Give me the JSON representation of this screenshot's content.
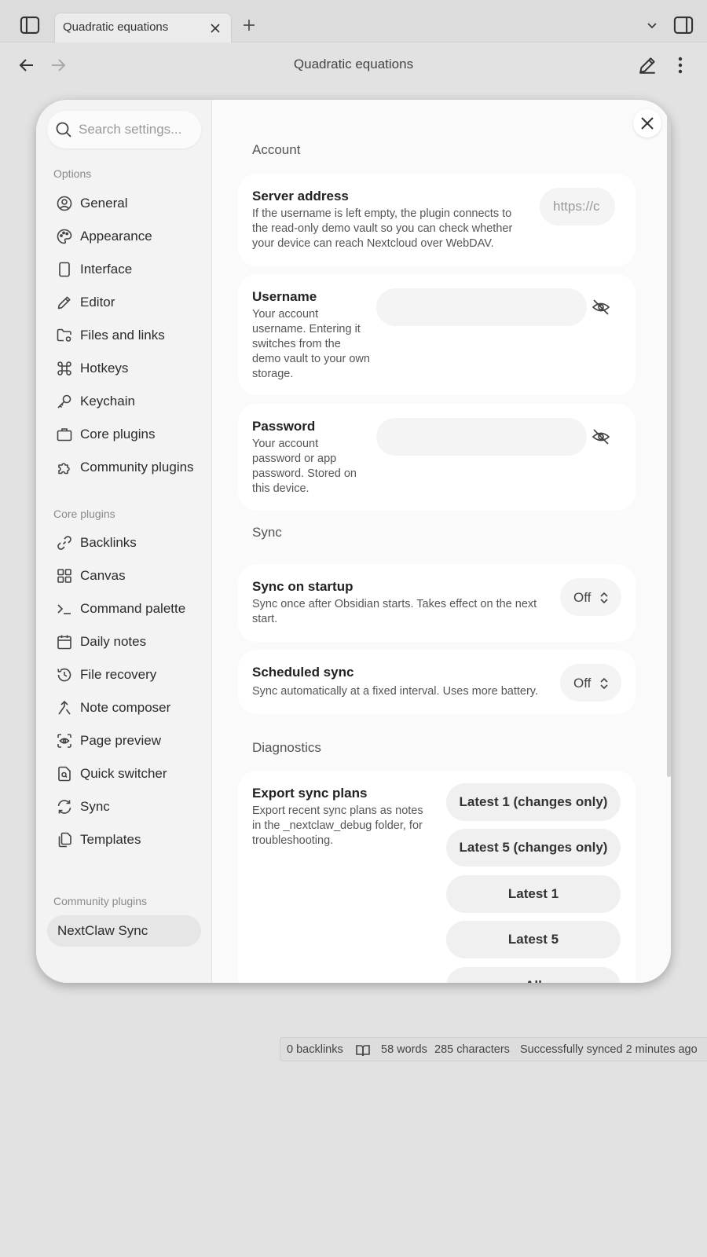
{
  "tab": {
    "title": "Quadratic equations"
  },
  "nav": {
    "title": "Quadratic equations"
  },
  "sidebar": {
    "search_placeholder": "Search settings...",
    "options_label": "Options",
    "options": [
      {
        "label": "General",
        "icon": "user-circle-icon"
      },
      {
        "label": "Appearance",
        "icon": "palette-icon"
      },
      {
        "label": "Interface",
        "icon": "tablet-icon"
      },
      {
        "label": "Editor",
        "icon": "pencil-icon"
      },
      {
        "label": "Files and links",
        "icon": "folder-cog-icon"
      },
      {
        "label": "Hotkeys",
        "icon": "command-icon"
      },
      {
        "label": "Keychain",
        "icon": "key-icon"
      },
      {
        "label": "Core plugins",
        "icon": "briefcase-icon"
      },
      {
        "label": "Community plugins",
        "icon": "puzzle-icon"
      }
    ],
    "core_label": "Core plugins",
    "core": [
      {
        "label": "Backlinks",
        "icon": "link-icon"
      },
      {
        "label": "Canvas",
        "icon": "layout-grid-icon"
      },
      {
        "label": "Command palette",
        "icon": "terminal-icon"
      },
      {
        "label": "Daily notes",
        "icon": "calendar-icon"
      },
      {
        "label": "File recovery",
        "icon": "history-icon"
      },
      {
        "label": "Note composer",
        "icon": "merge-icon"
      },
      {
        "label": "Page preview",
        "icon": "scan-eye-icon"
      },
      {
        "label": "Quick switcher",
        "icon": "file-search-icon"
      },
      {
        "label": "Sync",
        "icon": "refresh-icon"
      },
      {
        "label": "Templates",
        "icon": "files-icon"
      }
    ],
    "community_label": "Community plugins",
    "community": [
      {
        "label": "NextClaw Sync",
        "selected": true
      }
    ]
  },
  "settings": {
    "account_heading": "Account",
    "server": {
      "name": "Server address",
      "desc": "If the username is left empty, the plugin connects to the read-only demo vault so you can check whether your device can reach Nextcloud over WebDAV.",
      "placeholder": "https://c"
    },
    "username": {
      "name": "Username",
      "desc": "Your account username. Entering it switches from the demo vault to your own storage.",
      "value": ""
    },
    "password": {
      "name": "Password",
      "desc": "Your account password or app password. Stored on this device.",
      "value": ""
    },
    "sync_heading": "Sync",
    "sync_on_startup": {
      "name": "Sync on startup",
      "desc": "Sync once after Obsidian starts. Takes effect on the next start.",
      "value": "Off"
    },
    "scheduled_sync": {
      "name": "Scheduled sync",
      "desc": "Sync automatically at a fixed interval. Uses more battery.",
      "value": "Off"
    },
    "diagnostics_heading": "Diagnostics",
    "export": {
      "name": "Export sync plans",
      "desc": "Export recent sync plans as notes in the _nextclaw_debug folder, for troubleshooting.",
      "buttons": [
        "Latest 1 (changes only)",
        "Latest 5 (changes only)",
        "Latest 1",
        "Latest 5",
        "All"
      ]
    }
  },
  "status": {
    "backlinks": "0 backlinks",
    "words": "58 words",
    "characters": "285 characters",
    "sync": "Successfully synced 2 minutes ago"
  }
}
